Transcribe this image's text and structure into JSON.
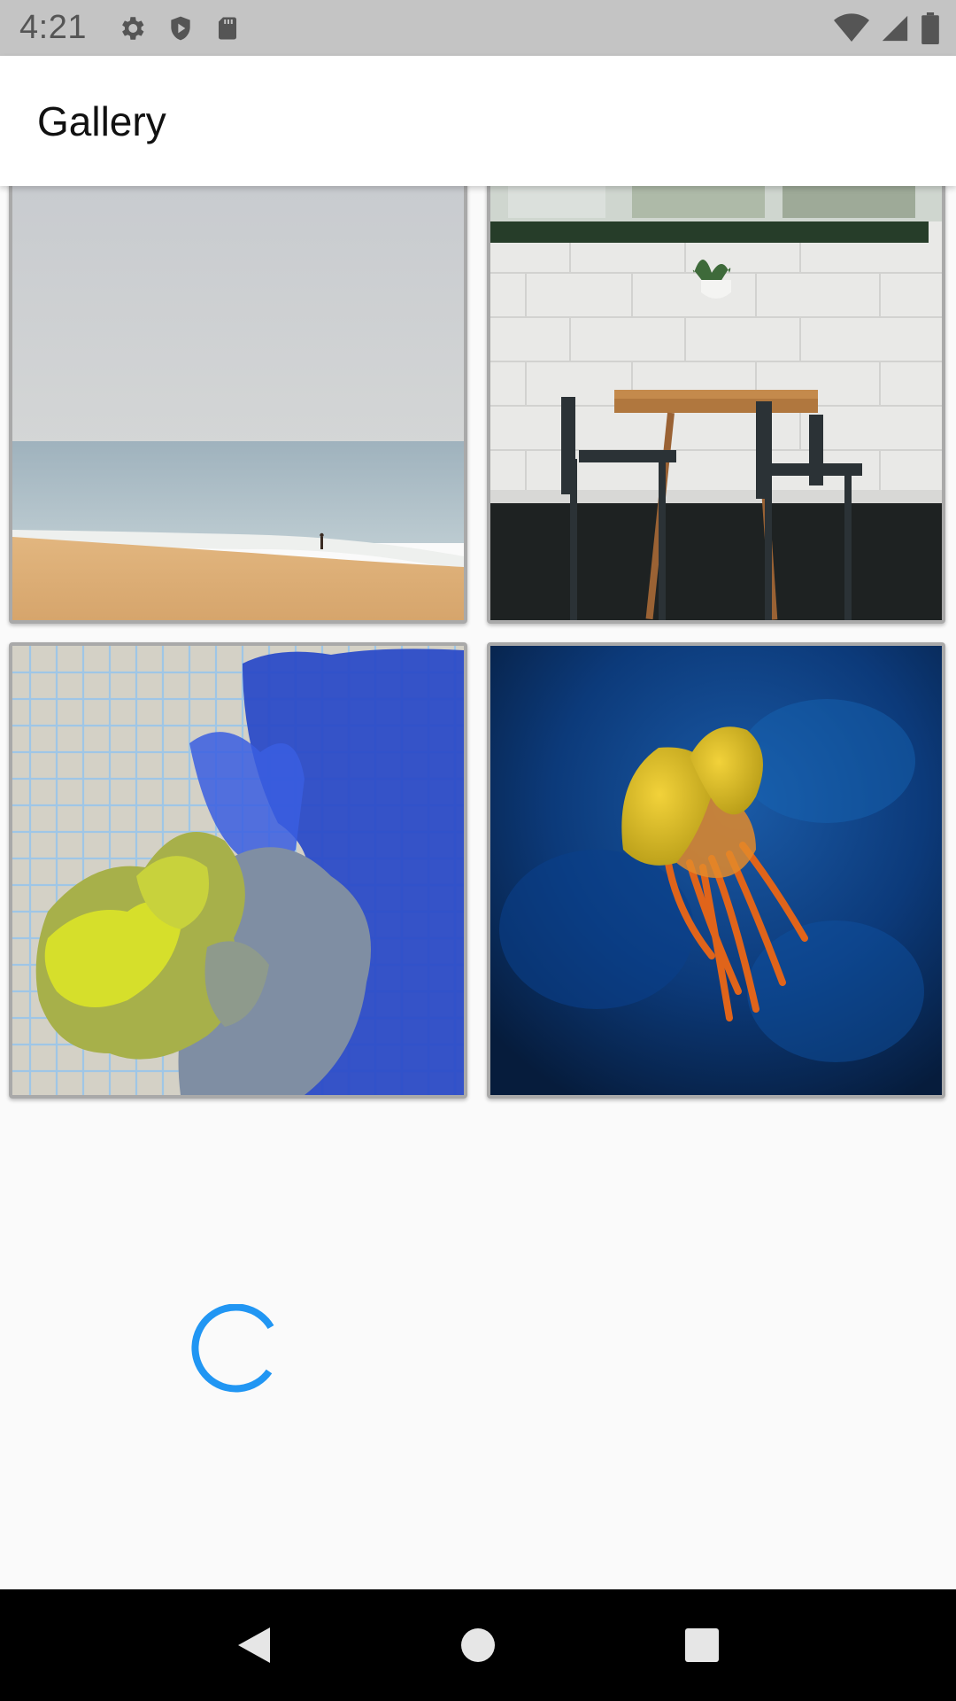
{
  "status_bar": {
    "time": "4:21",
    "left_icons": [
      "gear-icon",
      "shield-icon",
      "sd-card-icon"
    ],
    "right_icons": [
      "wifi-icon",
      "cellular-signal-icon",
      "battery-icon"
    ]
  },
  "app_bar": {
    "title": "Gallery"
  },
  "gallery": {
    "images": [
      {
        "name": "beach-photo"
      },
      {
        "name": "cafe-table-photo"
      },
      {
        "name": "coral-grid-photo"
      },
      {
        "name": "jellyfish-photo"
      }
    ],
    "loading": true
  },
  "nav_bar": {
    "buttons": [
      "back-icon",
      "home-icon",
      "recents-icon"
    ]
  },
  "colors": {
    "status_bar_bg": "#c4c4c4",
    "app_bar_bg": "#ffffff",
    "page_bg": "#fafafa",
    "spinner": "#2196f3",
    "nav_bar_bg": "#000000"
  }
}
